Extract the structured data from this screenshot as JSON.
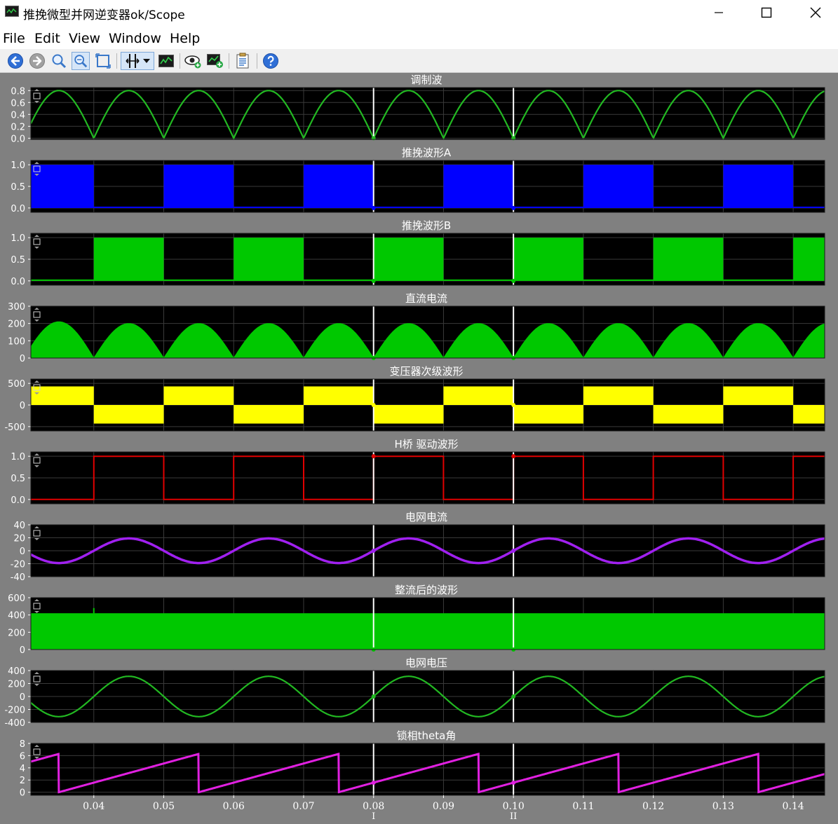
{
  "window": {
    "title": "推挽微型并网逆变器ok/Scope",
    "minimize_icon": "minimize-icon",
    "maximize_icon": "maximize-icon",
    "close_icon": "close-icon"
  },
  "menu": [
    "File",
    "Edit",
    "View",
    "Window",
    "Help"
  ],
  "toolbar": [
    {
      "icon": "back-arrow-icon",
      "color": "#2f6fd6"
    },
    {
      "icon": "forward-arrow-icon",
      "color": "#9a9a9a"
    },
    {
      "icon": "zoom-icon"
    },
    {
      "icon": "zoom-x-icon"
    },
    {
      "icon": "autoscale-icon"
    },
    {
      "icon": "cursor-measure-icon"
    },
    {
      "icon": "dropdown-arrow-icon"
    },
    {
      "icon": "signal-statistics-icon"
    },
    {
      "icon": "signal-selector-icon"
    },
    {
      "icon": "add-plot-icon"
    },
    {
      "icon": "parameters-icon"
    },
    {
      "icon": "help-icon",
      "color": "#2f6fd6"
    }
  ],
  "cursors": {
    "values": [
      0.08,
      0.1
    ],
    "labels": [
      "I",
      "II"
    ],
    "color": "#ffffff"
  },
  "chart_data": {
    "type": "line",
    "xlim": [
      0.031,
      0.1445
    ],
    "xticks": [
      0.04,
      0.05,
      0.06,
      0.07,
      0.08,
      0.09,
      0.1,
      0.11,
      0.12,
      0.13,
      0.14
    ],
    "xtick_labels": [
      "0.04",
      "0.05",
      "0.06",
      "0.07",
      "0.08",
      "0.09",
      "0.10",
      "0.11",
      "0.12",
      "0.13",
      "0.14"
    ],
    "grid": true,
    "background": "#000000",
    "panels": [
      {
        "title": "调制波",
        "color": "#22b922",
        "ylim": [
          -0.02,
          0.85
        ],
        "yticks": [
          0,
          0.2,
          0.4,
          0.6,
          0.8
        ],
        "ytick_labels": [
          "0.0",
          "0.2",
          "0.4",
          "0.6",
          "0.8"
        ],
        "kind": "abs_sine",
        "amplitude": 0.8,
        "frequency_hz": 50,
        "phase_zero_at": 0.08
      },
      {
        "title": "推挽波形A",
        "color": "#0000ff",
        "ylim": [
          -0.1,
          1.1
        ],
        "yticks": [
          0,
          0.5,
          1.0
        ],
        "ytick_labels": [
          "0.0",
          "0.5",
          "1.0"
        ],
        "kind": "square",
        "high": 1.0,
        "low": 0.0,
        "high_intervals": [
          [
            0.03,
            0.04
          ],
          [
            0.05,
            0.06
          ],
          [
            0.07,
            0.08
          ],
          [
            0.09,
            0.1
          ],
          [
            0.11,
            0.12
          ],
          [
            0.13,
            0.14
          ]
        ]
      },
      {
        "title": "推挽波形B",
        "color": "#00c800",
        "ylim": [
          -0.1,
          1.1
        ],
        "yticks": [
          0,
          0.5,
          1.0
        ],
        "ytick_labels": [
          "0.0",
          "0.5",
          "1.0"
        ],
        "kind": "square",
        "high": 1.0,
        "low": 0.0,
        "high_intervals": [
          [
            0.04,
            0.05
          ],
          [
            0.06,
            0.07
          ],
          [
            0.08,
            0.09
          ],
          [
            0.1,
            0.11
          ],
          [
            0.12,
            0.13
          ],
          [
            0.14,
            0.15
          ]
        ]
      },
      {
        "title": "直流电流",
        "color": "#00c800",
        "ylim": [
          0,
          300
        ],
        "yticks": [
          0,
          100,
          200,
          300
        ],
        "ytick_labels": [
          "0",
          "100",
          "200",
          "300"
        ],
        "kind": "abs_sine_filled",
        "amplitude": 200,
        "frequency_hz": 50,
        "phase_zero_at": 0.08,
        "first_peak": 210
      },
      {
        "title": "变压器次级波形",
        "color": "#ffff00",
        "ylim": [
          -600,
          600
        ],
        "yticks": [
          -500,
          0,
          500
        ],
        "ytick_labels": [
          "-500",
          "0",
          "500"
        ],
        "kind": "bipolar_square_filled",
        "high": 430,
        "low": -430,
        "positive_intervals": [
          [
            0.03,
            0.04
          ],
          [
            0.05,
            0.06
          ],
          [
            0.07,
            0.08
          ],
          [
            0.09,
            0.1
          ],
          [
            0.11,
            0.12
          ],
          [
            0.13,
            0.14
          ]
        ]
      },
      {
        "title": "H桥 驱动波形",
        "color": "#e00000",
        "ylim": [
          -0.1,
          1.1
        ],
        "yticks": [
          0,
          0.5,
          1.0
        ],
        "ytick_labels": [
          "0.0",
          "0.5",
          "1.0"
        ],
        "kind": "square_line",
        "high": 1.0,
        "low": 0.0,
        "high_intervals": [
          [
            0.04,
            0.05
          ],
          [
            0.06,
            0.07
          ],
          [
            0.08,
            0.09
          ],
          [
            0.1,
            0.11
          ],
          [
            0.12,
            0.13
          ],
          [
            0.14,
            0.15
          ]
        ]
      },
      {
        "title": "电网电流",
        "color": "#a020f0",
        "ylim": [
          -40,
          40
        ],
        "yticks": [
          -40,
          -20,
          0,
          20,
          40
        ],
        "ytick_labels": [
          "-40",
          "-20",
          "0",
          "20",
          "40"
        ],
        "kind": "sine",
        "amplitude": 19,
        "frequency_hz": 50,
        "phase_zero_at": 0.08
      },
      {
        "title": "整流后的波形",
        "color": "#00c800",
        "ylim": [
          0,
          600
        ],
        "yticks": [
          0,
          200,
          400,
          600
        ],
        "ytick_labels": [
          "0",
          "200",
          "400",
          "600"
        ],
        "kind": "filled_band",
        "level": 420,
        "spike_at": 0.04,
        "spike_value": 480
      },
      {
        "title": "电网电压",
        "color": "#22b922",
        "ylim": [
          -400,
          400
        ],
        "yticks": [
          -400,
          -200,
          0,
          200,
          400
        ],
        "ytick_labels": [
          "-400",
          "-200",
          "0",
          "200",
          "400"
        ],
        "kind": "sine",
        "amplitude": 311,
        "frequency_hz": 50,
        "phase_zero_at": 0.08
      },
      {
        "title": "锁相theta角",
        "color": "#e020e0",
        "ylim": [
          -0.5,
          8
        ],
        "yticks": [
          0,
          2,
          4,
          6,
          8
        ],
        "ytick_labels": [
          "0",
          "2",
          "4",
          "6",
          "8"
        ],
        "kind": "sawtooth",
        "max": 6.28,
        "period": 0.02,
        "reset_at": 0.035
      }
    ]
  }
}
